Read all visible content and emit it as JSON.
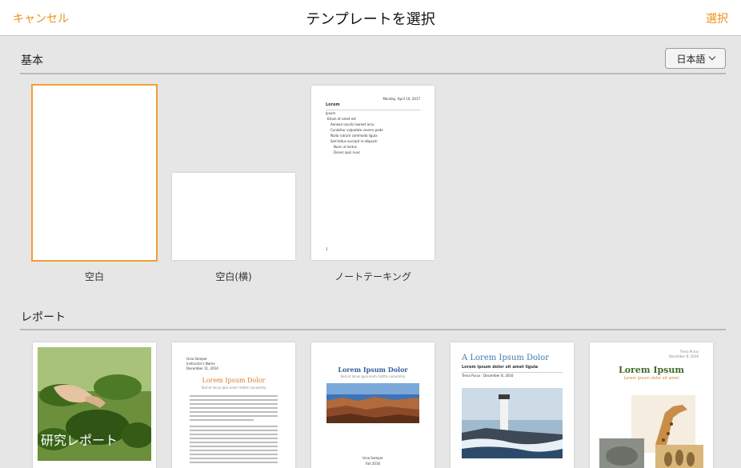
{
  "navbar": {
    "cancel_label": "キャンセル",
    "title": "テンプレートを選択",
    "select_label": "選択"
  },
  "basic": {
    "title": "基本",
    "language_button": "日本語",
    "templates": [
      {
        "label": "空白"
      },
      {
        "label": "空白(横)"
      },
      {
        "label": "ノートテーキング"
      }
    ],
    "note_preview": {
      "date": "Monday, April 10, 2017",
      "heading": "Lorem",
      "sub": "Ipsum",
      "items": [
        "Etiam et amet est",
        "Aenean iaculis laoreet arcu",
        "Curabitur vulputate viverra pede",
        "Nulla rutrum commodo ligula",
        "Sed tellus suscipit in aliquam",
        "Nunc ut lectus",
        "Donec quis nunc"
      ],
      "page_number": "1"
    }
  },
  "report": {
    "title": "レポート",
    "thumbs": [
      {
        "overlay": "研究レポート"
      },
      {
        "author": "Ursa Semper",
        "instructor": "Instructor's Name",
        "date": "December 11, 2014",
        "title": "Lorem Ipsum Dolor",
        "subtitle": "Sed et lacus quis enim mattis nonummy"
      },
      {
        "title": "Lorem Ipsum Dolor",
        "subtitle": "Sed et lacus quis enim mattis nonummy",
        "author": "Ursa Semper",
        "term": "Fall 2016"
      },
      {
        "title": "A Lorem Ipsum Dolor",
        "subtitle": "Lorem ipsum dolor sit amet ligula",
        "meta": "Trena Purus · December 8, 2016"
      },
      {
        "meta1": "Trena Purus",
        "meta2": "December 8, 2016",
        "title": "Lorem Ipsum",
        "subtitle": "Lorem ipsum dolor sit amet"
      }
    ]
  },
  "colors": {
    "accent": "#f0901a",
    "background": "#e6e6e6",
    "report_title_orange": "#e07a2a",
    "report_title_blue": "#3a5f9a",
    "report_title_green": "#3f6a2a"
  }
}
